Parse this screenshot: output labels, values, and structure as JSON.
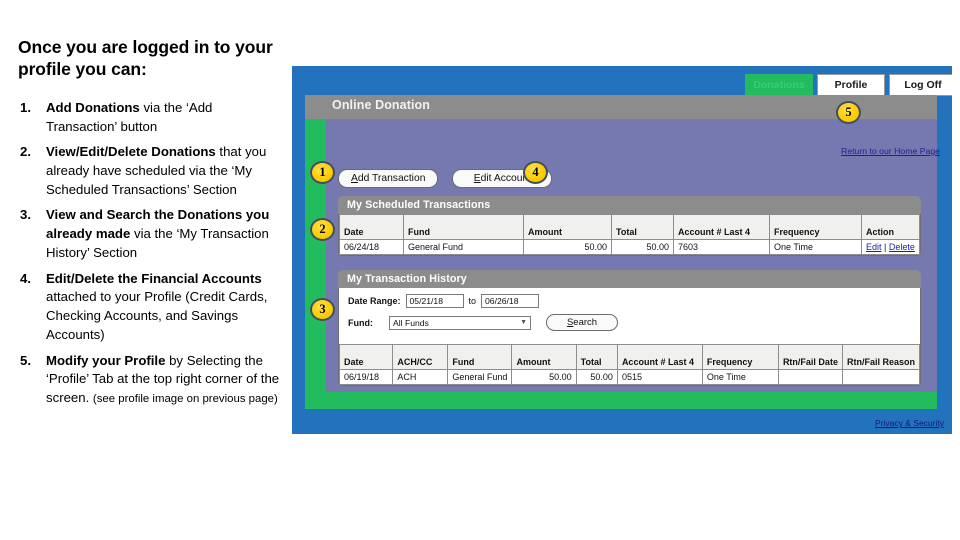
{
  "slide": {
    "heading": "Once you are logged in to your profile you can:",
    "steps": [
      {
        "num": "1.",
        "bold1": "Add Donations",
        "rest1": " via the ‘Add Transaction’ button"
      },
      {
        "num": "2.",
        "bold1": "View/Edit/Delete Donations",
        "rest1": " that you already have scheduled via the ‘My Scheduled Transactions’ Section"
      },
      {
        "num": "3.",
        "bold1": "View and Search the Donations you already made",
        "rest1": " via the ‘My Transaction History’ Section"
      },
      {
        "num": "4.",
        "bold1": "Edit/Delete the Financial Accounts",
        "rest1": " attached to your Profile (Credit Cards, Checking Accounts, and Savings Accounts)"
      },
      {
        "num": "5.",
        "bold1": "Modify your Profile",
        "rest1": " by Selecting the ‘Profile’ Tab at the top right corner of the screen. ",
        "note": "(see profile image on previous page)"
      }
    ]
  },
  "screenshot": {
    "tabs": [
      {
        "label": "Donations",
        "active": true
      },
      {
        "label": "Profile",
        "active": false
      },
      {
        "label": "Log Off",
        "active": false
      }
    ],
    "app_title": "Online Donation",
    "home_link": "Return to our Home Page",
    "privacy_link": "Privacy & Security",
    "toolbar": {
      "add_transaction": "Add Transaction",
      "add_transaction_accel": "A",
      "edit_account": "Edit Account",
      "edit_account_accel": "E"
    },
    "scheduled": {
      "title": "My Scheduled Transactions",
      "columns": [
        "Date",
        "Fund",
        "Amount",
        "Total",
        "Account # Last 4",
        "Frequency",
        "Action"
      ],
      "rows": [
        {
          "date": "06/24/18",
          "fund": "General Fund",
          "amount": "50.00",
          "total": "50.00",
          "account": "7603",
          "frequency": "One Time",
          "action_edit": "Edit",
          "action_sep": "|",
          "action_delete": "Delete"
        }
      ]
    },
    "history": {
      "title": "My Transaction History",
      "date_range_label": "Date Range:",
      "date_from": "05/21/18",
      "to_label": "to",
      "date_to": "06/26/18",
      "fund_label": "Fund:",
      "fund_value": "All Funds",
      "search_label": "Search",
      "search_accel": "S",
      "columns": [
        "Date",
        "ACH/CC",
        "Fund",
        "Amount",
        "Total",
        "Account # Last 4",
        "Frequency",
        "Rtn/Fail Date",
        "Rtn/Fail Reason"
      ],
      "rows": [
        {
          "date": "06/19/18",
          "achcc": "ACH",
          "fund": "General Fund",
          "amount": "50.00",
          "total": "50.00",
          "account": "0515",
          "frequency": "One Time",
          "rtn_date": "",
          "rtn_reason": ""
        }
      ]
    },
    "callouts": [
      {
        "num": "1"
      },
      {
        "num": "2"
      },
      {
        "num": "3"
      },
      {
        "num": "4"
      },
      {
        "num": "5"
      }
    ]
  },
  "colors": {
    "page_blue": "#2272bd",
    "app_green": "#22bb5e",
    "band_gray": "#8c8c8c",
    "content_purple": "#7579b0",
    "badge_gold": "#ffcd06",
    "link_blue": "#1f1f9a"
  }
}
